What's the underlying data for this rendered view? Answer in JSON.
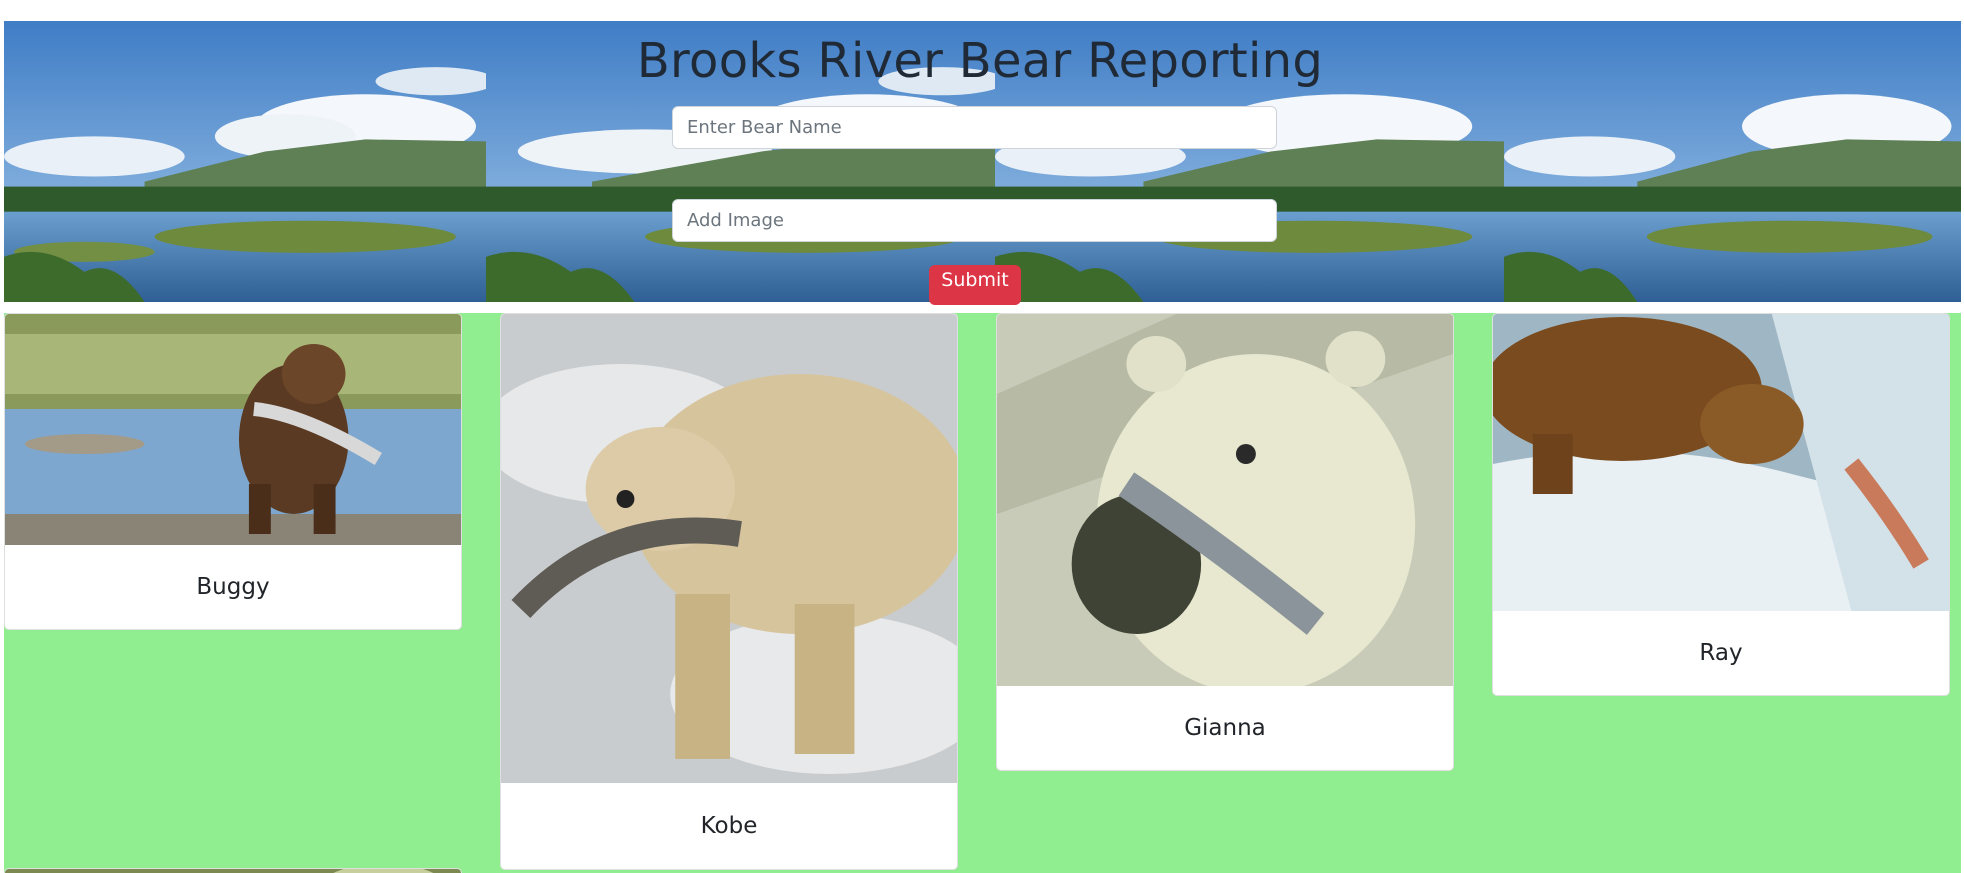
{
  "page": {
    "title": "Brooks River Bear Reporting"
  },
  "form": {
    "name_placeholder": "Enter Bear Name",
    "image_placeholder": "Add Image",
    "submit_label": "Submit"
  },
  "colors": {
    "gallery_background": "#90ee90",
    "submit_button": "#dc3545"
  },
  "bears": [
    {
      "name": "Buggy",
      "image": "brown bear standing in river holding fish"
    },
    {
      "name": "Kobe",
      "image": "pale bear on rocks holding salmon"
    },
    {
      "name": "Gianna",
      "image": "cream-colored cub biting fish"
    },
    {
      "name": "Ray",
      "image": "brown bear at waterfall catching leaping salmon"
    }
  ]
}
